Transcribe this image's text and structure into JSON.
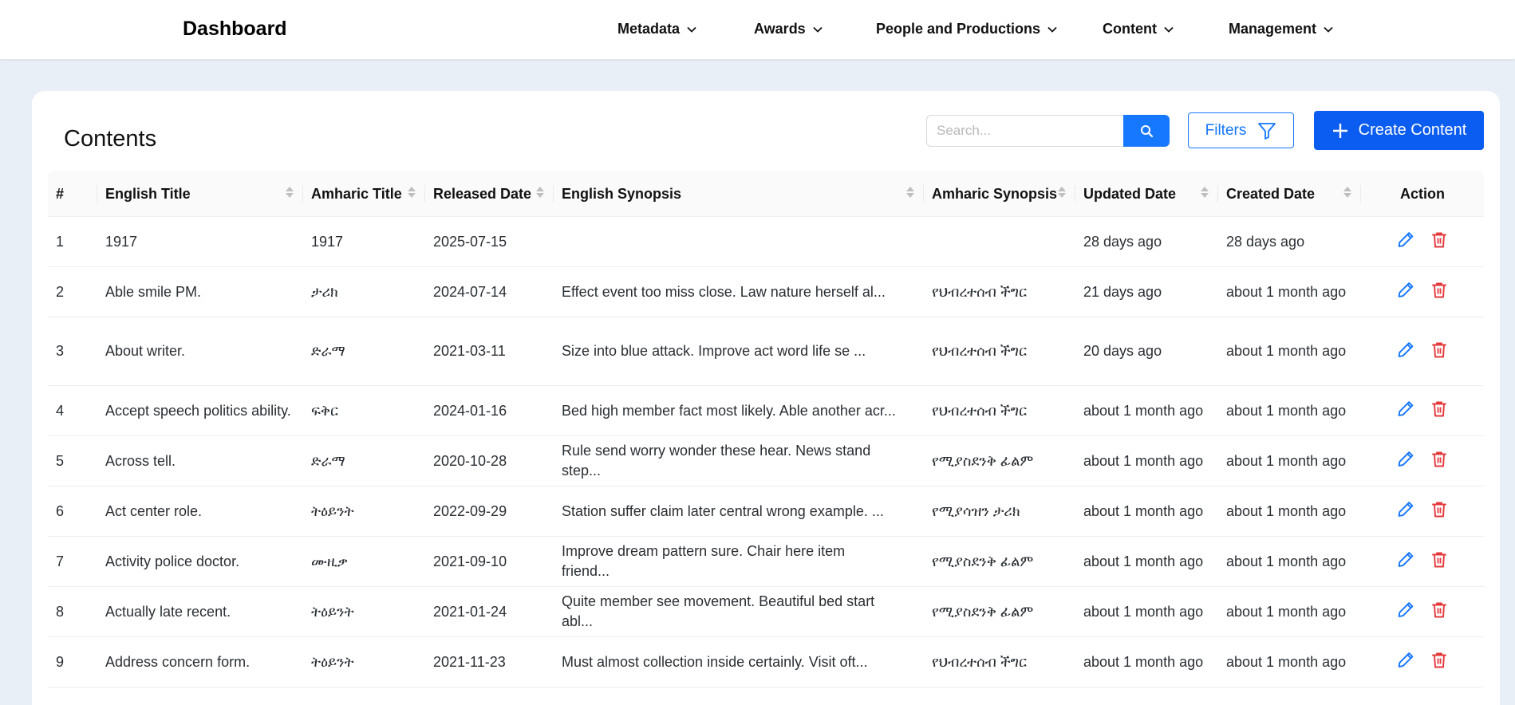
{
  "nav": {
    "brand": "Dashboard",
    "items": [
      {
        "label": "Metadata"
      },
      {
        "label": "Awards"
      },
      {
        "label": "People and Productions"
      },
      {
        "label": "Content"
      },
      {
        "label": "Management"
      }
    ]
  },
  "page": {
    "title": "Contents",
    "search_placeholder": "Search...",
    "filters_label": "Filters",
    "create_label": "Create Content"
  },
  "table": {
    "columns": [
      "#",
      "English Title",
      "Amharic Title",
      "Released Date",
      "English Synopsis",
      "Amharic Synopsis",
      "Updated Date",
      "Created Date",
      "Action"
    ],
    "rows": [
      {
        "num": "1",
        "en_title": "1917",
        "am_title": "1917",
        "released": "2025-07-15",
        "en_synopsis": "",
        "am_synopsis": "",
        "updated": "28 days ago",
        "created": "28 days ago"
      },
      {
        "num": "2",
        "en_title": "Able smile PM.",
        "am_title": "ታሪክ",
        "released": "2024-07-14",
        "en_synopsis": "Effect event too miss close. Law nature herself al...",
        "am_synopsis": "የህብረተሰብ ችግር",
        "updated": "21 days ago",
        "created": "about 1 month ago"
      },
      {
        "num": "3",
        "en_title": "About writer.",
        "am_title": "ድራማ",
        "released": "2021-03-11",
        "en_synopsis": "Size into blue attack. Improve act word life se ...",
        "am_synopsis": "የህብረተሰብ ችግር",
        "updated": "20 days ago",
        "created": "about 1 month ago"
      },
      {
        "num": "4",
        "en_title": "Accept speech politics ability.",
        "am_title": "ፍቅር",
        "released": "2024-01-16",
        "en_synopsis": "Bed high member fact most likely. Able another acr...",
        "am_synopsis": "የህብረተሰብ ችግር",
        "updated": "about 1 month ago",
        "created": "about 1 month ago"
      },
      {
        "num": "5",
        "en_title": "Across tell.",
        "am_title": "ድራማ",
        "released": "2020-10-28",
        "en_synopsis": "Rule send worry wonder these hear. News stand step...",
        "am_synopsis": "የሚያስደንቅ ፊልም",
        "updated": "about 1 month ago",
        "created": "about 1 month ago"
      },
      {
        "num": "6",
        "en_title": "Act center role.",
        "am_title": "ትዕይንት",
        "released": "2022-09-29",
        "en_synopsis": "Station suffer claim later central wrong example. ...",
        "am_synopsis": "የሚያሳዝን ታሪክ",
        "updated": "about 1 month ago",
        "created": "about 1 month ago"
      },
      {
        "num": "7",
        "en_title": "Activity police doctor.",
        "am_title": "ሙዚቃ",
        "released": "2021-09-10",
        "en_synopsis": "Improve dream pattern sure. Chair here item friend...",
        "am_synopsis": "የሚያስደንቅ ፊልም",
        "updated": "about 1 month ago",
        "created": "about 1 month ago"
      },
      {
        "num": "8",
        "en_title": "Actually late recent.",
        "am_title": "ትዕይንት",
        "released": "2021-01-24",
        "en_synopsis": "Quite member see movement. Beautiful bed start abl...",
        "am_synopsis": "የሚያስደንቅ ፊልም",
        "updated": "about 1 month ago",
        "created": "about 1 month ago"
      },
      {
        "num": "9",
        "en_title": "Address concern form.",
        "am_title": "ትዕይንት",
        "released": "2021-11-23",
        "en_synopsis": "Must almost collection inside certainly. Visit oft...",
        "am_synopsis": "የህብረተሰብ ችግር",
        "updated": "about 1 month ago",
        "created": "about 1 month ago"
      }
    ]
  },
  "colors": {
    "primary": "#1677ff",
    "create_button": "#0b5cf0",
    "delete": "#e5383b",
    "background": "#e9eff6"
  },
  "icons": {
    "search": "search-icon",
    "filter": "filter-icon",
    "plus": "plus-icon",
    "edit": "pencil-icon",
    "delete": "trash-icon",
    "dropdown": "chevron-down-icon",
    "sort": "sort-icon"
  }
}
